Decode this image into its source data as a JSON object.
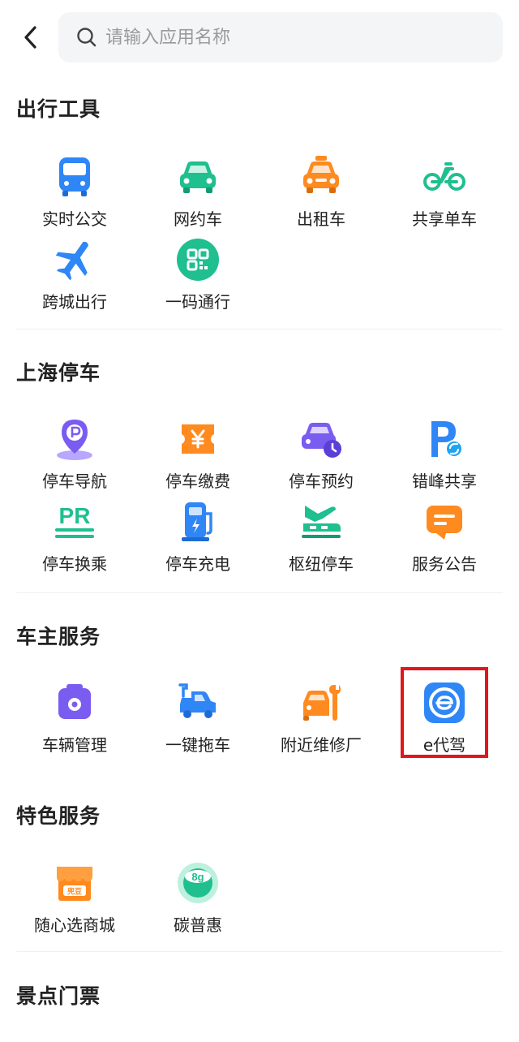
{
  "search": {
    "placeholder": "请输入应用名称"
  },
  "sections": [
    {
      "title": "出行工具",
      "items": [
        {
          "label": "实时公交",
          "icon": "bus-icon"
        },
        {
          "label": "网约车",
          "icon": "car-icon"
        },
        {
          "label": "出租车",
          "icon": "taxi-icon"
        },
        {
          "label": "共享单车",
          "icon": "bicycle-icon"
        },
        {
          "label": "跨城出行",
          "icon": "airplane-icon"
        },
        {
          "label": "一码通行",
          "icon": "qr-code-icon"
        }
      ]
    },
    {
      "title": "上海停车",
      "items": [
        {
          "label": "停车导航",
          "icon": "parking-pin-icon"
        },
        {
          "label": "停车缴费",
          "icon": "yen-ticket-icon"
        },
        {
          "label": "停车预约",
          "icon": "car-clock-icon"
        },
        {
          "label": "错峰共享",
          "icon": "parking-share-icon"
        },
        {
          "label": "停车换乘",
          "icon": "park-ride-icon"
        },
        {
          "label": "停车充电",
          "icon": "charging-station-icon"
        },
        {
          "label": "枢纽停车",
          "icon": "transit-hub-icon"
        },
        {
          "label": "服务公告",
          "icon": "message-icon"
        }
      ]
    },
    {
      "title": "车主服务",
      "items": [
        {
          "label": "车辆管理",
          "icon": "vehicle-manage-icon"
        },
        {
          "label": "一键拖车",
          "icon": "tow-truck-icon"
        },
        {
          "label": "附近维修厂",
          "icon": "repair-shop-icon"
        },
        {
          "label": "e代驾",
          "icon": "e-driver-icon"
        }
      ]
    },
    {
      "title": "特色服务",
      "items": [
        {
          "label": "随心选商城",
          "icon": "shop-icon"
        },
        {
          "label": "碳普惠",
          "icon": "carbon-globe-icon"
        }
      ]
    },
    {
      "title": "景点门票",
      "items": []
    }
  ],
  "colors": {
    "blue": "#2f86f6",
    "green": "#1fbf8f",
    "orange": "#ff8a1f",
    "purple": "#7b5cf0",
    "highlight_border": "#e3161b"
  }
}
